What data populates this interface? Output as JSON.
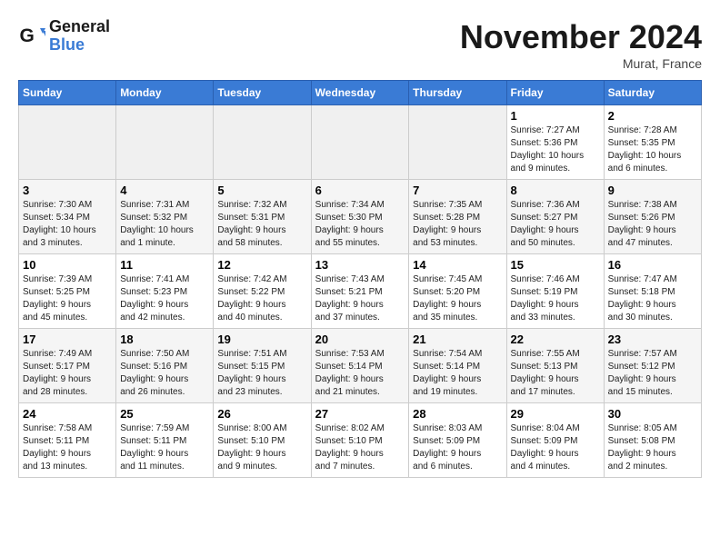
{
  "logo": {
    "line1": "General",
    "line2": "Blue"
  },
  "title": "November 2024",
  "location": "Murat, France",
  "weekdays": [
    "Sunday",
    "Monday",
    "Tuesday",
    "Wednesday",
    "Thursday",
    "Friday",
    "Saturday"
  ],
  "weeks": [
    [
      {
        "day": "",
        "info": ""
      },
      {
        "day": "",
        "info": ""
      },
      {
        "day": "",
        "info": ""
      },
      {
        "day": "",
        "info": ""
      },
      {
        "day": "",
        "info": ""
      },
      {
        "day": "1",
        "info": "Sunrise: 7:27 AM\nSunset: 5:36 PM\nDaylight: 10 hours\nand 9 minutes."
      },
      {
        "day": "2",
        "info": "Sunrise: 7:28 AM\nSunset: 5:35 PM\nDaylight: 10 hours\nand 6 minutes."
      }
    ],
    [
      {
        "day": "3",
        "info": "Sunrise: 7:30 AM\nSunset: 5:34 PM\nDaylight: 10 hours\nand 3 minutes."
      },
      {
        "day": "4",
        "info": "Sunrise: 7:31 AM\nSunset: 5:32 PM\nDaylight: 10 hours\nand 1 minute."
      },
      {
        "day": "5",
        "info": "Sunrise: 7:32 AM\nSunset: 5:31 PM\nDaylight: 9 hours\nand 58 minutes."
      },
      {
        "day": "6",
        "info": "Sunrise: 7:34 AM\nSunset: 5:30 PM\nDaylight: 9 hours\nand 55 minutes."
      },
      {
        "day": "7",
        "info": "Sunrise: 7:35 AM\nSunset: 5:28 PM\nDaylight: 9 hours\nand 53 minutes."
      },
      {
        "day": "8",
        "info": "Sunrise: 7:36 AM\nSunset: 5:27 PM\nDaylight: 9 hours\nand 50 minutes."
      },
      {
        "day": "9",
        "info": "Sunrise: 7:38 AM\nSunset: 5:26 PM\nDaylight: 9 hours\nand 47 minutes."
      }
    ],
    [
      {
        "day": "10",
        "info": "Sunrise: 7:39 AM\nSunset: 5:25 PM\nDaylight: 9 hours\nand 45 minutes."
      },
      {
        "day": "11",
        "info": "Sunrise: 7:41 AM\nSunset: 5:23 PM\nDaylight: 9 hours\nand 42 minutes."
      },
      {
        "day": "12",
        "info": "Sunrise: 7:42 AM\nSunset: 5:22 PM\nDaylight: 9 hours\nand 40 minutes."
      },
      {
        "day": "13",
        "info": "Sunrise: 7:43 AM\nSunset: 5:21 PM\nDaylight: 9 hours\nand 37 minutes."
      },
      {
        "day": "14",
        "info": "Sunrise: 7:45 AM\nSunset: 5:20 PM\nDaylight: 9 hours\nand 35 minutes."
      },
      {
        "day": "15",
        "info": "Sunrise: 7:46 AM\nSunset: 5:19 PM\nDaylight: 9 hours\nand 33 minutes."
      },
      {
        "day": "16",
        "info": "Sunrise: 7:47 AM\nSunset: 5:18 PM\nDaylight: 9 hours\nand 30 minutes."
      }
    ],
    [
      {
        "day": "17",
        "info": "Sunrise: 7:49 AM\nSunset: 5:17 PM\nDaylight: 9 hours\nand 28 minutes."
      },
      {
        "day": "18",
        "info": "Sunrise: 7:50 AM\nSunset: 5:16 PM\nDaylight: 9 hours\nand 26 minutes."
      },
      {
        "day": "19",
        "info": "Sunrise: 7:51 AM\nSunset: 5:15 PM\nDaylight: 9 hours\nand 23 minutes."
      },
      {
        "day": "20",
        "info": "Sunrise: 7:53 AM\nSunset: 5:14 PM\nDaylight: 9 hours\nand 21 minutes."
      },
      {
        "day": "21",
        "info": "Sunrise: 7:54 AM\nSunset: 5:14 PM\nDaylight: 9 hours\nand 19 minutes."
      },
      {
        "day": "22",
        "info": "Sunrise: 7:55 AM\nSunset: 5:13 PM\nDaylight: 9 hours\nand 17 minutes."
      },
      {
        "day": "23",
        "info": "Sunrise: 7:57 AM\nSunset: 5:12 PM\nDaylight: 9 hours\nand 15 minutes."
      }
    ],
    [
      {
        "day": "24",
        "info": "Sunrise: 7:58 AM\nSunset: 5:11 PM\nDaylight: 9 hours\nand 13 minutes."
      },
      {
        "day": "25",
        "info": "Sunrise: 7:59 AM\nSunset: 5:11 PM\nDaylight: 9 hours\nand 11 minutes."
      },
      {
        "day": "26",
        "info": "Sunrise: 8:00 AM\nSunset: 5:10 PM\nDaylight: 9 hours\nand 9 minutes."
      },
      {
        "day": "27",
        "info": "Sunrise: 8:02 AM\nSunset: 5:10 PM\nDaylight: 9 hours\nand 7 minutes."
      },
      {
        "day": "28",
        "info": "Sunrise: 8:03 AM\nSunset: 5:09 PM\nDaylight: 9 hours\nand 6 minutes."
      },
      {
        "day": "29",
        "info": "Sunrise: 8:04 AM\nSunset: 5:09 PM\nDaylight: 9 hours\nand 4 minutes."
      },
      {
        "day": "30",
        "info": "Sunrise: 8:05 AM\nSunset: 5:08 PM\nDaylight: 9 hours\nand 2 minutes."
      }
    ]
  ]
}
